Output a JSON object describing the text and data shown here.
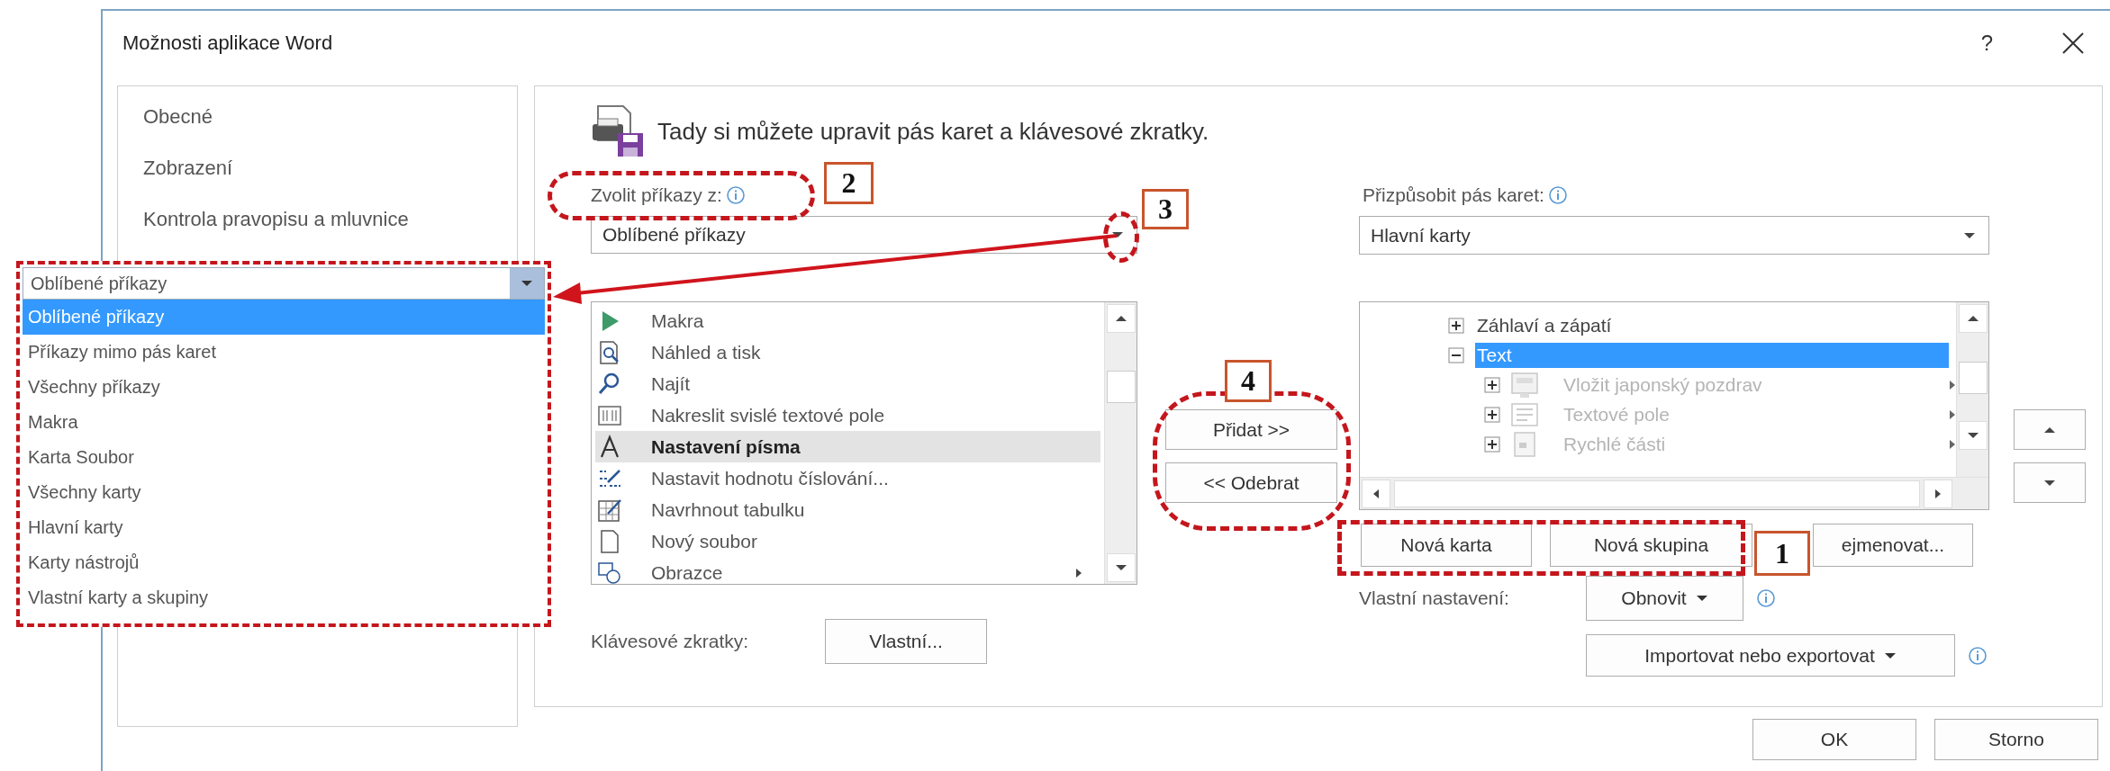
{
  "window": {
    "title": "Možnosti aplikace Word",
    "help": "?"
  },
  "sidebar": {
    "items": [
      "Obecné",
      "Zobrazení",
      "Kontrola pravopisu a mluvnice"
    ]
  },
  "header": {
    "text": "Tady si můžete upravit pás karet a klávesové zkratky."
  },
  "commands": {
    "label": "Zvolit příkazy z:",
    "value": "Oblíbené příkazy",
    "items": [
      {
        "label": "Makra",
        "kind": "play",
        "selected": false,
        "submenu": false
      },
      {
        "label": "Náhled a tisk",
        "kind": "preview",
        "selected": false,
        "submenu": false
      },
      {
        "label": "Najít",
        "kind": "find",
        "selected": false,
        "submenu": false
      },
      {
        "label": "Nakreslit svislé textové pole",
        "kind": "textbox",
        "selected": false,
        "submenu": false
      },
      {
        "label": "Nastavení písma",
        "kind": "font",
        "selected": true,
        "submenu": false
      },
      {
        "label": "Nastavit hodnotu číslování...",
        "kind": "numbering",
        "selected": false,
        "submenu": false
      },
      {
        "label": "Navrhnout tabulku",
        "kind": "table",
        "selected": false,
        "submenu": false
      },
      {
        "label": "Nový soubor",
        "kind": "document",
        "selected": false,
        "submenu": false
      },
      {
        "label": "Obrazce",
        "kind": "shapes",
        "selected": false,
        "submenu": true
      }
    ],
    "shortcuts_label": "Klávesové zkratky:",
    "shortcuts_button": "Vlastní..."
  },
  "transfer": {
    "add": "Přidat >>",
    "remove": "<< Odebrat"
  },
  "ribbon": {
    "label": "Přizpůsobit pás karet:",
    "value": "Hlavní karty",
    "tree": [
      {
        "label": "Záhlaví a zápatí",
        "expanded": false,
        "selected": false,
        "disabled": false,
        "submenu": false
      },
      {
        "label": "Text",
        "expanded": true,
        "selected": true,
        "disabled": false,
        "submenu": false,
        "children": [
          {
            "label": "Vložit japonský pozdrav",
            "kind": "card",
            "expanded": false,
            "selected": false,
            "disabled": true,
            "submenu": true
          },
          {
            "label": "Textové pole",
            "kind": "textbox",
            "expanded": false,
            "selected": false,
            "disabled": true,
            "submenu": true
          },
          {
            "label": "Rychlé části",
            "kind": "parts",
            "expanded": false,
            "selected": false,
            "disabled": true,
            "submenu": true
          }
        ]
      }
    ],
    "new_tab": "Nová karta",
    "new_group": "Nová skupina",
    "rename": "ejmenovat...",
    "custom_label": "Vlastní nastavení:",
    "reset": "Obnovit",
    "import_export": "Importovat nebo exportovat"
  },
  "footer": {
    "buttons": [
      "OK",
      "Storno"
    ]
  },
  "popup": {
    "value": "Oblíbené příkazy",
    "options": [
      {
        "label": "Oblíbené příkazy",
        "selected": true
      },
      {
        "label": "Příkazy mimo pás karet",
        "selected": false
      },
      {
        "label": "Všechny příkazy",
        "selected": false
      },
      {
        "label": "Makra",
        "selected": false
      },
      {
        "label": "Karta Soubor",
        "selected": false
      },
      {
        "label": "Všechny karty",
        "selected": false
      },
      {
        "label": "Hlavní karty",
        "selected": false
      },
      {
        "label": "Karty nástrojů",
        "selected": false
      },
      {
        "label": "Vlastní karty a skupiny",
        "selected": false
      }
    ]
  },
  "annotations": [
    "2",
    "3",
    "4",
    "1"
  ]
}
